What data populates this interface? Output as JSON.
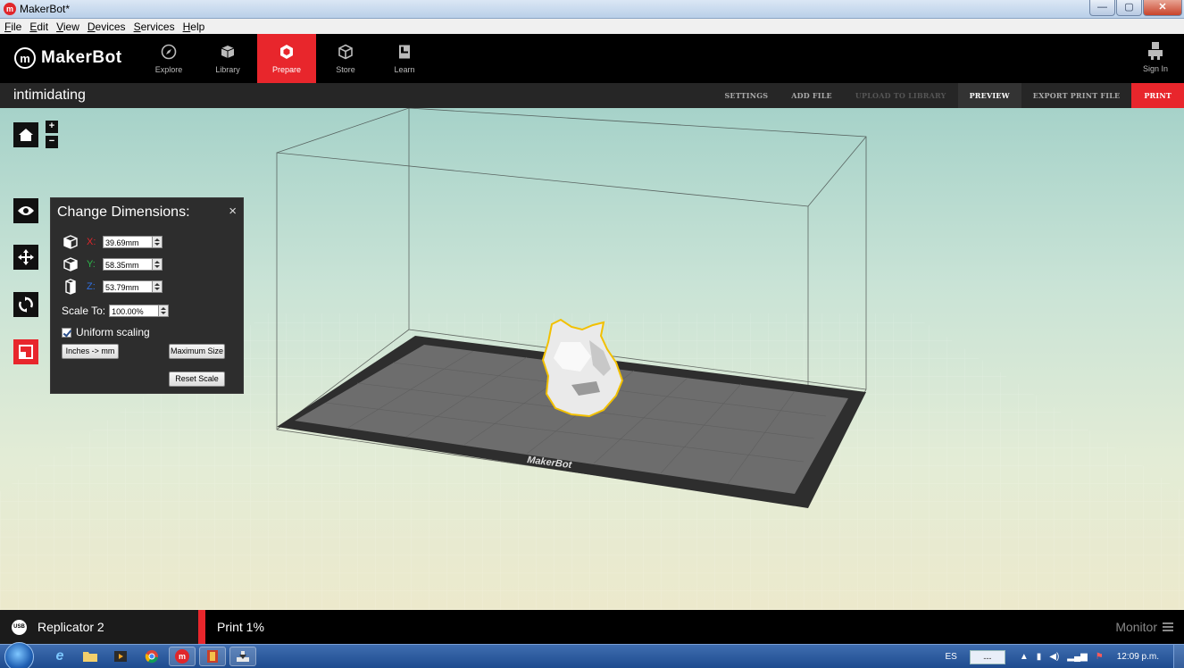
{
  "window": {
    "title": "MakerBot*",
    "controls": {
      "minimize": "—",
      "maximize": "▢",
      "close": "✕"
    }
  },
  "menu": [
    "File",
    "Edit",
    "View",
    "Devices",
    "Services",
    "Help"
  ],
  "header": {
    "brand": "MakerBot",
    "nav": [
      {
        "label": "Explore",
        "icon": "compass-icon"
      },
      {
        "label": "Library",
        "icon": "library-icon"
      },
      {
        "label": "Prepare",
        "icon": "prepare-icon"
      },
      {
        "label": "Store",
        "icon": "store-cube-icon"
      },
      {
        "label": "Learn",
        "icon": "learn-book-icon"
      }
    ],
    "active_nav": "Prepare",
    "signin_label": "Sign In"
  },
  "subbar": {
    "file_name": "intimidating",
    "actions": {
      "settings": "SETTINGS",
      "add_file": "ADD FILE",
      "upload": "UPLOAD TO LIBRARY",
      "preview": "PREVIEW",
      "export": "EXPORT PRINT FILE",
      "print": "PRINT"
    }
  },
  "viewport": {
    "build_plate_label": "MakerBot",
    "zoom_in": "+",
    "zoom_out": "−"
  },
  "dimensions_panel": {
    "title": "Change Dimensions:",
    "close": "×",
    "x_label": "X:",
    "x_value": "39.69mm",
    "y_label": "Y:",
    "y_value": "58.35mm",
    "z_label": "Z:",
    "z_value": "53.79mm",
    "scale_label": "Scale To:",
    "scale_value": "100.00%",
    "uniform_label": "Uniform scaling",
    "uniform_checked": true,
    "inches_button": "Inches -> mm",
    "max_size_button": "Maximum Size",
    "reset_button": "Reset Scale",
    "colors": {
      "x": "#e0262b",
      "y": "#2db84a",
      "z": "#2f6fe0"
    }
  },
  "statusbar": {
    "usb_label": "USB",
    "device": "Replicator 2",
    "print_status": "Print 1%",
    "monitor": "Monitor"
  },
  "taskbar": {
    "language": "ES",
    "ime": "---",
    "clock": "12:09 p.m."
  },
  "colors": {
    "accent": "#e8262c",
    "header_bg": "#000000",
    "subbar_bg": "#262626"
  }
}
